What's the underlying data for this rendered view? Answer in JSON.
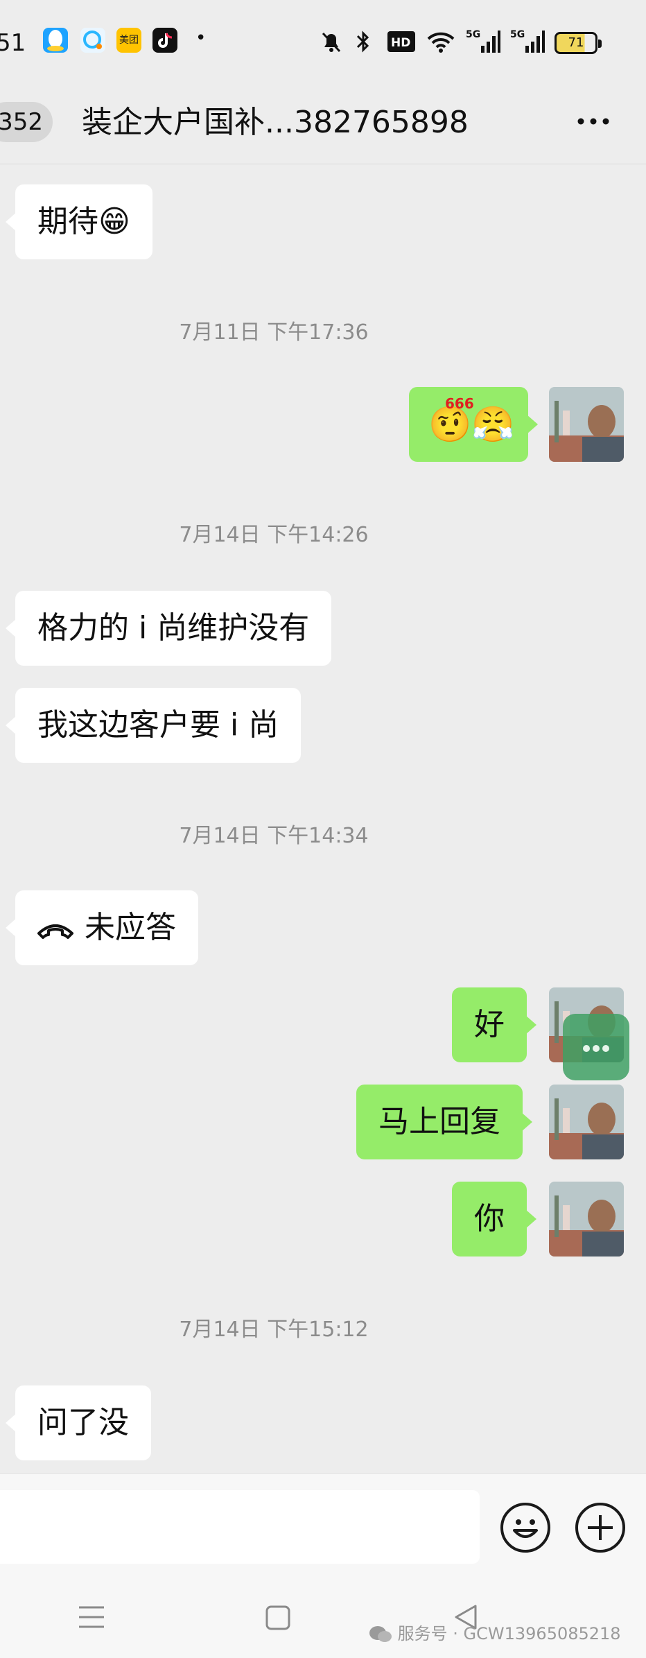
{
  "status_bar": {
    "time": "51",
    "apps": [
      {
        "name": "qq-icon",
        "label": "",
        "color": "#1ea3ff"
      },
      {
        "name": "chat-app-icon",
        "label": "",
        "color": "#2ab7ff"
      },
      {
        "name": "meituan-icon",
        "label": "美团",
        "color": "#ffc300"
      },
      {
        "name": "douyin-icon",
        "label": "",
        "color": "#111111"
      }
    ],
    "battery_level": "71"
  },
  "header": {
    "unread_count": "352",
    "title": "装企大户国补...382765898"
  },
  "messages": [
    {
      "text": "期待😁"
    },
    {
      "timestamp": "7月11日 下午17:36"
    },
    {
      "sticker": "🤨😤",
      "sticker_tag": "666"
    },
    {
      "timestamp": "7月14日 下午14:26"
    },
    {
      "text": "格力的 i 尚维护没有"
    },
    {
      "text": "我这边客户要 i 尚"
    },
    {
      "timestamp": "7月14日 下午14:34"
    },
    {
      "text": "未应答"
    },
    {
      "text": "好"
    },
    {
      "text": "马上回复"
    },
    {
      "text": "你"
    },
    {
      "timestamp": "7月14日 下午15:12"
    },
    {
      "text": "问了没"
    }
  ],
  "input": {
    "placeholder": ""
  },
  "watermark": {
    "text": "服务号 · GCW13965085218"
  },
  "colors": {
    "background": "#ededed",
    "outgoing_bubble": "#95ec69",
    "incoming_bubble": "#ffffff",
    "timestamp_text": "#8c8c8c"
  }
}
